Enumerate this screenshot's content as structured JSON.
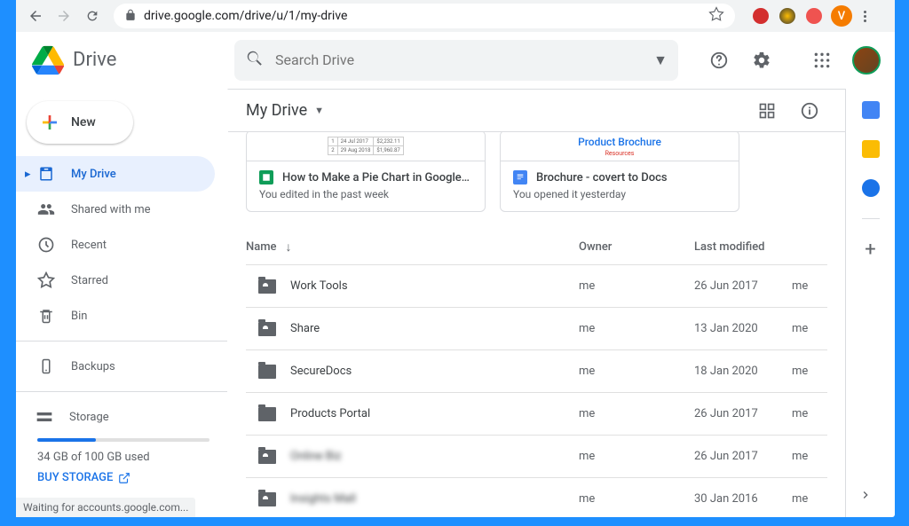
{
  "browser": {
    "url": "drive.google.com/drive/u/1/my-drive",
    "profile_initial": "V",
    "status": "Waiting for accounts.google.com..."
  },
  "app": {
    "name": "Drive",
    "search_placeholder": "Search Drive"
  },
  "sidebar": {
    "new_label": "New",
    "items": [
      {
        "label": "My Drive",
        "active": true
      },
      {
        "label": "Shared with me"
      },
      {
        "label": "Recent"
      },
      {
        "label": "Starred"
      },
      {
        "label": "Bin"
      },
      {
        "label": "Backups"
      }
    ],
    "storage": {
      "label": "Storage",
      "usage": "34 GB of 100 GB used",
      "buy": "BUY STORAGE"
    }
  },
  "breadcrumb": "My Drive",
  "quick_cards": [
    {
      "preview_text": "",
      "title": "How to Make a Pie Chart in Google S...",
      "subtitle": "You edited in the past week",
      "type": "sheets"
    },
    {
      "preview_text": "Product Brochure",
      "title": "Brochure - covert to Docs",
      "subtitle": "You opened it yesterday",
      "type": "docs"
    }
  ],
  "columns": {
    "name": "Name",
    "owner": "Owner",
    "modified": "Last modified"
  },
  "files": [
    {
      "name": "Work Tools",
      "owner": "me",
      "modified": "26 Jun 2017",
      "by": "me",
      "shared": true
    },
    {
      "name": "Share",
      "owner": "me",
      "modified": "13 Jan 2020",
      "by": "me",
      "shared": true
    },
    {
      "name": "SecureDocs",
      "owner": "me",
      "modified": "18 Jan 2020",
      "by": "me",
      "shared": false
    },
    {
      "name": "Products Portal",
      "owner": "me",
      "modified": "26 Jun 2017",
      "by": "me",
      "shared": false
    },
    {
      "name": "Online Biz",
      "owner": "me",
      "modified": "26 Jun 2017",
      "by": "me",
      "shared": true,
      "blurred": true
    },
    {
      "name": "Insights Mall",
      "owner": "me",
      "modified": "30 Jan 2016",
      "by": "me",
      "shared": true,
      "blurred": true
    }
  ]
}
